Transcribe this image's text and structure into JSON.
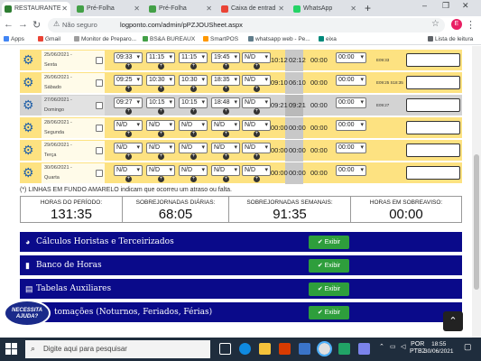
{
  "browser": {
    "tabs": [
      {
        "label": "RESTAURANTE",
        "color": "#2e7d32",
        "active": true
      },
      {
        "label": "Pré-Folha",
        "color": "#43a047"
      },
      {
        "label": "Pré-Folha",
        "color": "#43a047"
      },
      {
        "label": "Caixa de entrad",
        "color": "#ea4335"
      },
      {
        "label": "WhatsApp",
        "color": "#25d366"
      }
    ],
    "new_tab": "+",
    "security_text": "Não seguro",
    "url": "logponto.com/admin/pPZJOUSheet.aspx",
    "profile_initial": "E",
    "bookmarks": [
      "Apps",
      "Gmail",
      "Monitor de Preparo...",
      "BS&A BUREAUX",
      "SmartPOS",
      "whatsapp web - Pe...",
      "eixa"
    ],
    "reading_list": "Lista de leitura"
  },
  "timesheet": {
    "rows": [
      {
        "date": "25/06/2021 -",
        "weekday": "Sexta",
        "e1": "09:33",
        "s1": "11:15",
        "e2": "11:15",
        "s2": "19:45",
        "just": "N/D",
        "total": "10:12",
        "extra": "02:12",
        "delay": "00:00",
        "abono": "00:00",
        "obs": "E09:33",
        "gray": false
      },
      {
        "date": "26/06/2021 -",
        "weekday": "Sábado",
        "e1": "09:25",
        "s1": "10:30",
        "e2": "10:30",
        "s2": "18:35",
        "just": "N/D",
        "total": "09:10",
        "extra": "06:10",
        "delay": "00:00",
        "abono": "00:00",
        "obs": "E09:25 S18:35",
        "gray": false
      },
      {
        "date": "27/06/2021 -",
        "weekday": "Domingo",
        "e1": "09:27",
        "s1": "10:15",
        "e2": "10:15",
        "s2": "18:48",
        "just": "N/D",
        "total": "09:21",
        "extra": "09:21",
        "delay": "00:00",
        "abono": "00:00",
        "obs": "E09:27",
        "gray": true
      },
      {
        "date": "28/06/2021 -",
        "weekday": "Segunda",
        "e1": "N/D",
        "s1": "N/D",
        "e2": "N/D",
        "s2": "N/D",
        "just": "N/D",
        "total": "00:00",
        "extra": "00:00",
        "delay": "00:00",
        "abono": "00:00",
        "obs": "",
        "gray": false
      },
      {
        "date": "29/06/2021 -",
        "weekday": "Terça",
        "e1": "N/D",
        "s1": "N/D",
        "e2": "N/D",
        "s2": "N/D",
        "just": "N/D",
        "total": "00:00",
        "extra": "00:00",
        "delay": "00:00",
        "abono": "00:00",
        "obs": "",
        "gray": false
      },
      {
        "date": "30/06/2021 -",
        "weekday": "Quarta",
        "e1": "N/D",
        "s1": "N/D",
        "e2": "N/D",
        "s2": "N/D",
        "just": "N/D",
        "total": "00:00",
        "extra": "00:00",
        "delay": "00:00",
        "abono": "00:00",
        "obs": "",
        "gray": false
      }
    ],
    "footnote": "(*) LINHAS EM FUNDO AMARELO indicam que ocorreu um atraso ou falta."
  },
  "totals": [
    {
      "label": "HORAS DO PERÍODO:",
      "value": "131:35"
    },
    {
      "label": "SOBREJORNADAS DIÁRIAS:",
      "value": "68:05"
    },
    {
      "label": "SOBREJORNADAS SEMANAIS:",
      "value": "91:35"
    },
    {
      "label": "HORAS EM SOBREAVISO:",
      "value": "00:00"
    }
  ],
  "panels": [
    {
      "title": "Cálculos Horistas e Terceirizados",
      "icon": "dashboard-icon",
      "button": "✔ Exibir"
    },
    {
      "title": "Banco de Horas",
      "icon": "book-icon",
      "button": "✔ Exibir"
    },
    {
      "title": "Tabelas Auxiliares",
      "icon": "table-icon",
      "button": "✔ Exibir"
    },
    {
      "title": "tomações (Noturnos, Feriados, Férias)",
      "icon": "",
      "button": "✔ Exibir"
    }
  ],
  "help_bubble": "NECESSITA AJUDA?",
  "taskbar": {
    "search_placeholder": "Digite aqui para pesquisar",
    "lang": "POR",
    "layout": "PTB2",
    "time": "18:55",
    "date": "30/06/2021"
  }
}
